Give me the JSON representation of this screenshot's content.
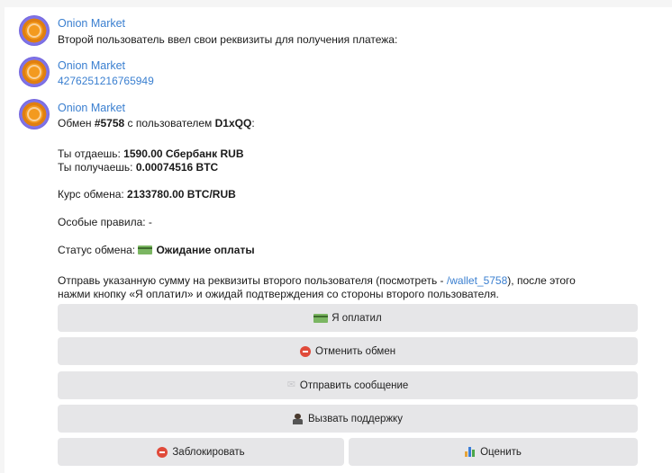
{
  "messages": [
    {
      "sender": "Onion Market",
      "text": "Второй пользователь ввел свои реквизиты для получения платежа:"
    },
    {
      "sender": "Onion Market",
      "text": "4276251216765949"
    },
    {
      "sender": "Onion Market"
    }
  ],
  "exchange": {
    "line1_prefix": "Обмен ",
    "line1_id": "#5758",
    "line1_mid": " с пользователем ",
    "line1_user": "D1xQQ",
    "line1_suffix": ":",
    "give_label": "Ты отдаешь: ",
    "give_value": "1590.00 Сбербанк RUB",
    "get_label": "Ты получаешь: ",
    "get_value": "0.00074516 BTC",
    "rate_label": "Курс обмена: ",
    "rate_value": "2133780.00 BTC/RUB",
    "rules": "Особые правила: -",
    "status_label": "Статус обмена: ",
    "status_value": "Ожидание оплаты",
    "instr1_a": "Отправь указанную сумму на реквизиты второго пользователя (посмотреть - ",
    "instr1_link": "/wallet_5758",
    "instr1_b": "), после этого",
    "instr2": "нажми кнопку «Я оплатил» и ожидай подтверждения со стороны второго пользователя."
  },
  "buttons": {
    "paid": "Я оплатил",
    "cancel": "Отменить обмен",
    "send_message": "Отправить сообщение",
    "support": "Вызвать поддержку",
    "block": "Заблокировать",
    "rate": "Оценить"
  },
  "icons": {
    "paid": "card-icon",
    "cancel": "stop-icon",
    "send_message": "envelope-icon",
    "support": "support-agent-icon",
    "block": "no-entry-icon",
    "rate": "bar-chart-icon"
  }
}
